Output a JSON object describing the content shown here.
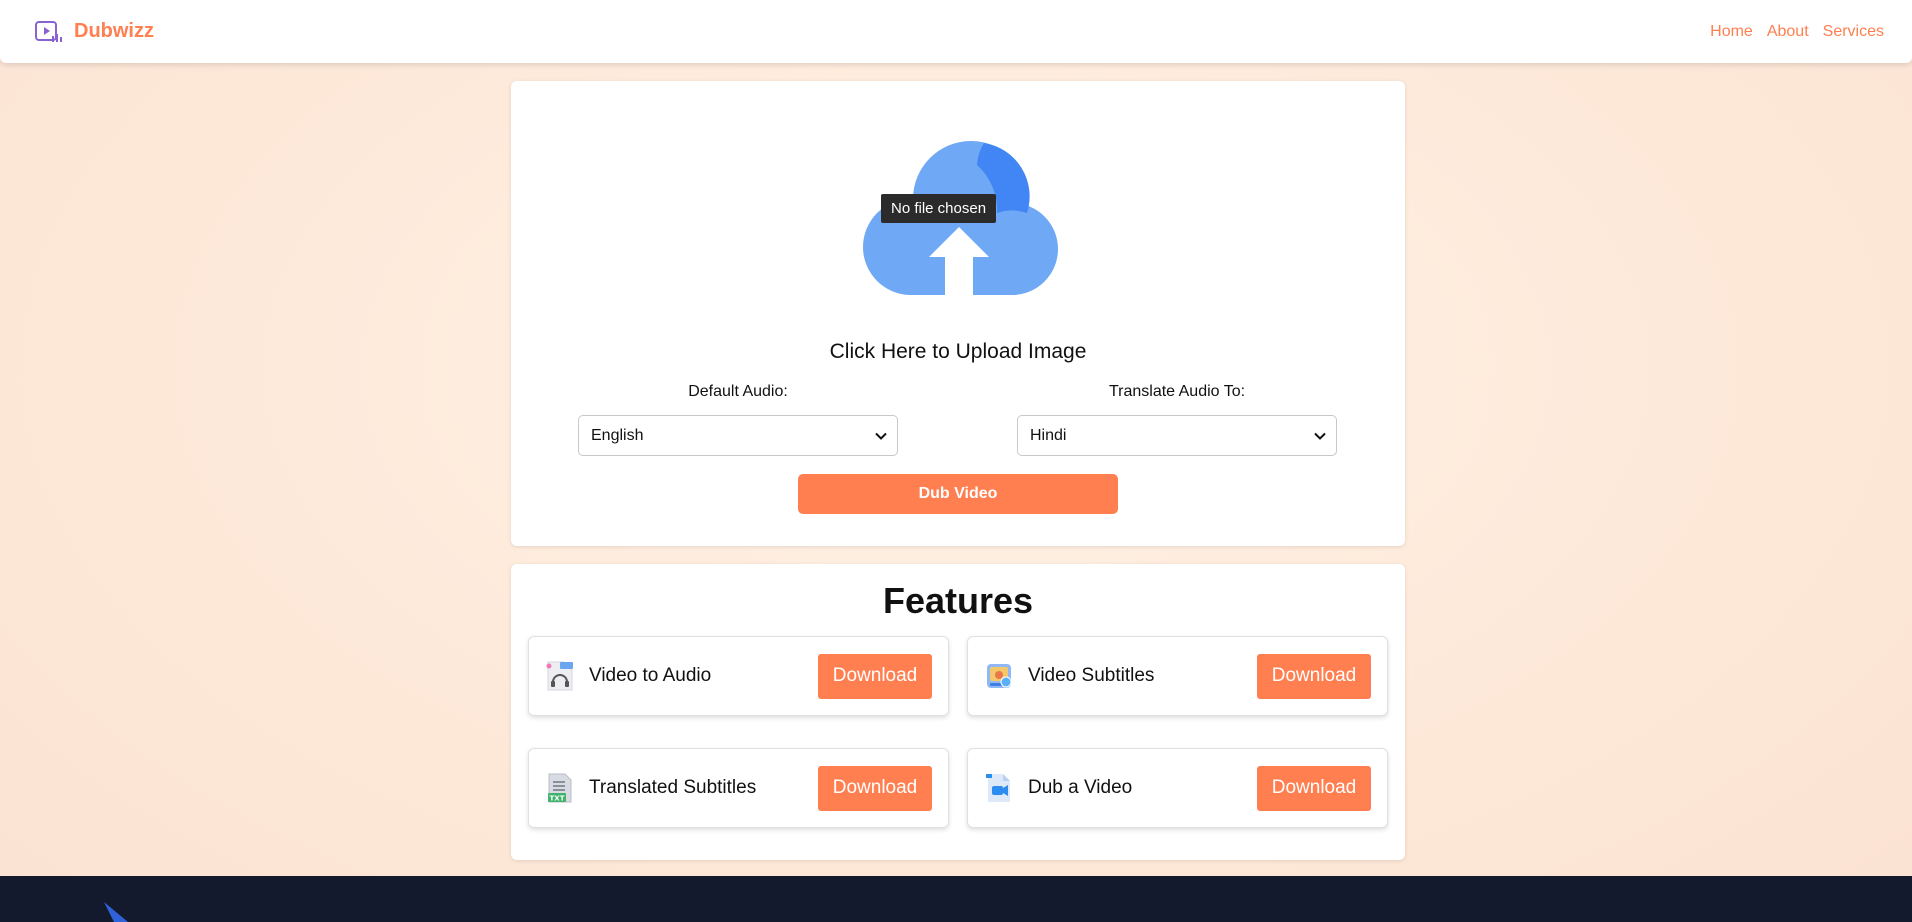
{
  "navbar": {
    "brand": "Dubwizz",
    "logo_icon": "video-audio-icon",
    "links": [
      "Home",
      "About",
      "Services"
    ]
  },
  "upload": {
    "icon": "cloud-upload-icon",
    "file_status": "No file chosen",
    "label": "Click Here to Upload Image",
    "default_audio": {
      "label": "Default Audio:",
      "value": "English"
    },
    "translate_audio": {
      "label": "Translate Audio To:",
      "value": "Hindi"
    },
    "dub_button": "Dub Video"
  },
  "features": {
    "title": "Features",
    "items": [
      {
        "label": "Video to Audio",
        "icon": "mp3-headphones-icon",
        "button": "Download"
      },
      {
        "label": "Video Subtitles",
        "icon": "subtitles-image-icon",
        "button": "Download"
      },
      {
        "label": "Translated Subtitles",
        "icon": "txt-file-icon",
        "button": "Download"
      },
      {
        "label": "Dub a Video",
        "icon": "video-file-icon",
        "button": "Download"
      }
    ]
  },
  "colors": {
    "accent": "#ff7f50",
    "footer": "#141a2e",
    "cloud_light": "#6fa8f5",
    "cloud_dark": "#4285f4"
  }
}
